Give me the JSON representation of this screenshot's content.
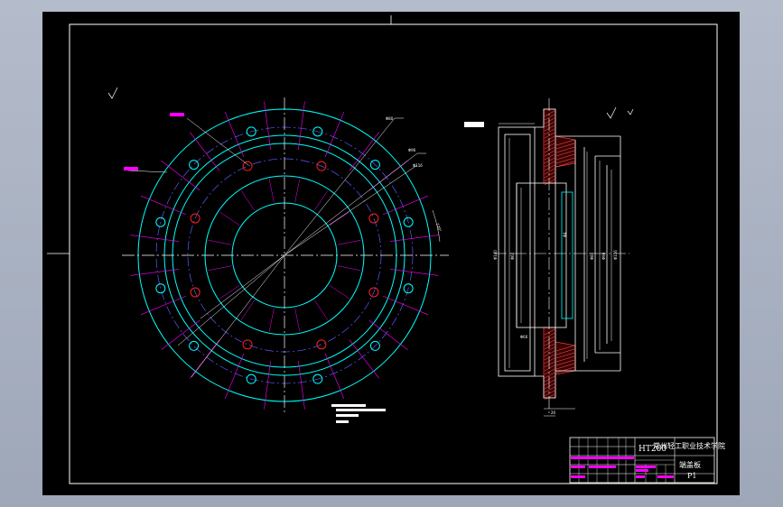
{
  "title_block": {
    "material": "HT200",
    "school": "常州轻工职业技术学院",
    "part_name": "端盖板",
    "sheet": "P1"
  },
  "colors": {
    "background": "#000000",
    "outline": "#ffffff",
    "cyan": "#00ffff",
    "magenta": "#ff00ff",
    "blue_center": "#5a5aff",
    "red_hole": "#ff2020",
    "hatch": "#ff6060",
    "frame_bg": "#aab2c3"
  }
}
